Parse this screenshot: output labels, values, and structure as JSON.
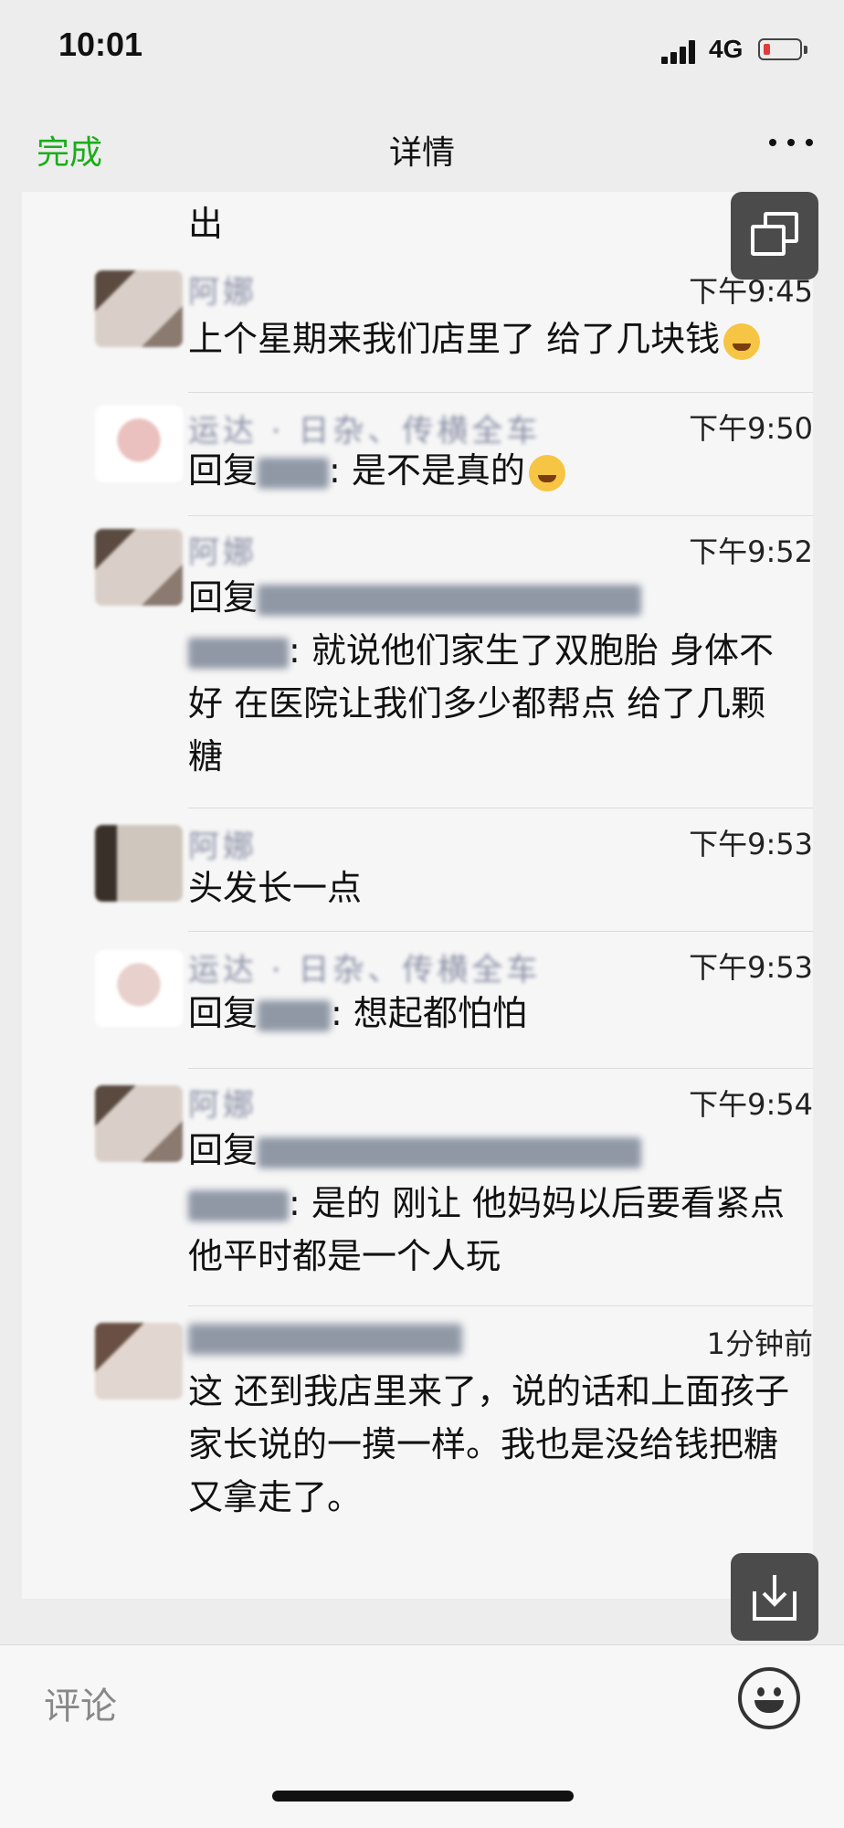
{
  "status_bar": {
    "time": "10:01",
    "network": "4G",
    "battery_color": "#e23b3b"
  },
  "nav": {
    "done_label": "完成",
    "title": "详情",
    "more_icon": "more-dots-icon"
  },
  "previous_comment_tail": "出",
  "comments": [
    {
      "avatar_colors": [
        "#d9cfc8",
        "#5a4a40"
      ],
      "name": "阿娜",
      "time": "下午9:45",
      "text": "上个星期来我们店里了  给了几块钱",
      "has_emoji": true
    },
    {
      "avatar_colors": [
        "#eac1be",
        "#ffffff"
      ],
      "name": "运达 · 日杂、传横全车",
      "time": "下午9:50",
      "reply_prefix": "回复",
      "reply_suffix": ": 是不是真的",
      "has_emoji": true
    },
    {
      "avatar_colors": [
        "#d9cfc8",
        "#5a4a40"
      ],
      "name": "阿娜",
      "time": "下午9:52",
      "reply_prefix": "回复",
      "reply_suffix": ": 就说他们家生了双胞胎  身体不好  在医院让我们多少都帮点  给了几颗糖"
    },
    {
      "avatar_colors": [
        "#cfc6bd",
        "#3a302a"
      ],
      "name": "阿娜",
      "time": "下午9:53",
      "text": "头发长一点"
    },
    {
      "avatar_colors": [
        "#e8d0cc",
        "#ffffff"
      ],
      "name": "运达 · 日杂、传横全车",
      "time": "下午9:53",
      "reply_prefix": "回复",
      "reply_suffix": ": 想起都怕怕"
    },
    {
      "avatar_colors": [
        "#d9cfc8",
        "#5a4a40"
      ],
      "name": "阿娜",
      "time": "下午9:54",
      "reply_prefix": "回复",
      "reply_suffix": ": 是的  刚让 他妈妈以后要看紧点  他平时都是一个人玩"
    },
    {
      "avatar_colors": [
        "#e2d6d0",
        "#6a5044"
      ],
      "name": "小",
      "time": "1分钟前",
      "text": "这     还到我店里来了，说的话和上面孩子家长说的一摸一样。我也是没给钱把糖又拿走了。"
    }
  ],
  "floating": {
    "window_icon": "floating-window-icon",
    "save_icon": "save-download-icon"
  },
  "input": {
    "placeholder": "评论",
    "emoji_icon": "smiley-icon"
  }
}
